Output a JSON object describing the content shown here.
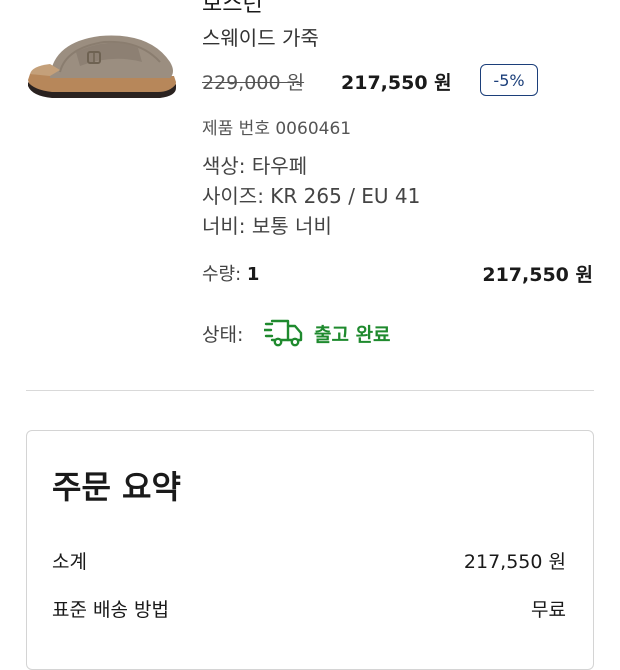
{
  "product": {
    "title_partial": "보스턴",
    "subtitle": "스웨이드 가죽",
    "original_price": "229,000 원",
    "sale_price": "217,550 원",
    "discount": "-5%",
    "product_number": "제품 번호 0060461",
    "color": "색상: 타우페",
    "size": "사이즈: KR 265 / EU 41",
    "width": "너비: 보통 너비",
    "quantity_label": "수량:",
    "quantity_value": "1",
    "line_total": "217,550 원",
    "status_label": "상태:",
    "status_value": "출고 완료",
    "status_color": "#1f8a2e",
    "status_icon": "delivery-truck-icon"
  },
  "summary": {
    "title": "주문 요약",
    "rows": [
      {
        "label": "소계",
        "value": "217,550 원"
      },
      {
        "label": "표준 배송 방법",
        "value": "무료"
      }
    ]
  },
  "colors": {
    "badge_border": "#1c3f7a",
    "divider": "#d9d9d9"
  }
}
